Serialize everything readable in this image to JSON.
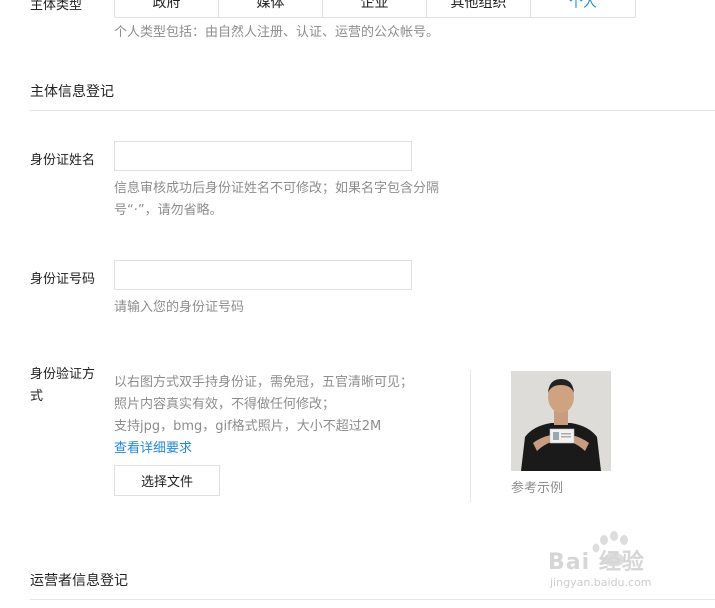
{
  "subject_type": {
    "label": "主体类型",
    "options": [
      "政府",
      "媒体",
      "企业",
      "其他组织",
      "个人"
    ],
    "selected": "个人",
    "hint": "个人类型包括：由自然人注册、认证、运营的公众帐号。"
  },
  "section_subject_info": {
    "title": "主体信息登记"
  },
  "id_name": {
    "label": "身份证姓名",
    "value": "",
    "hint_line1": "信息审核成功后身份证姓名不可修改；如果名字包含分隔",
    "hint_line2": "号“·”，请勿省略。"
  },
  "id_number": {
    "label": "身份证号码",
    "value": "",
    "hint": "请输入您的身份证号码"
  },
  "id_verify": {
    "label_line1": "身份验证方",
    "label_line2": "式",
    "hint_line1": "以右图方式双手持身份证，需免冠，五官清晰可见；",
    "hint_line2": "照片内容真实有效，不得做任何修改；",
    "hint_line3": "支持jpg，bmg，gif格式照片，大小不超过2M",
    "details_link": "查看详细要求",
    "choose_file_button": "选择文件",
    "example_caption": "参考示例"
  },
  "section_operator_info": {
    "title": "运营者信息登记"
  },
  "watermark": {
    "brand": "Bai 经验",
    "url": "jingyan.baidu.com"
  },
  "colors": {
    "accent": "#1e88e5",
    "hint": "#8d8d8d",
    "border": "#e0e0e0"
  }
}
